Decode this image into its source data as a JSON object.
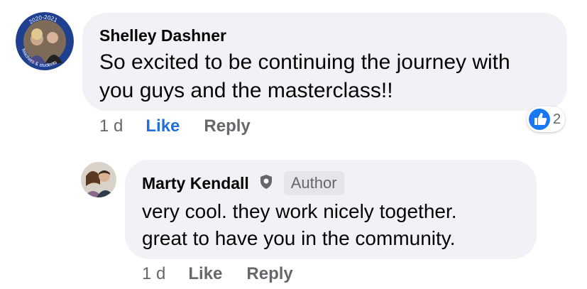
{
  "comments": [
    {
      "author": "Shelley Dashner",
      "text_lines": [
        "So excited to be continuing the journey with",
        "you guys and the masterclass!!"
      ],
      "time": "1 d",
      "like_label": "Like",
      "reply_label": "Reply",
      "reaction_count": "2",
      "avatar_text": "2020-2021",
      "avatar_caption": "teachers & students"
    },
    {
      "author": "Marty Kendall",
      "badge": "Author",
      "text_lines": [
        "very cool.  they work nicely together.",
        "great to have you in the community."
      ],
      "time": "1 d",
      "like_label": "Like",
      "reply_label": "Reply"
    }
  ],
  "icons": {
    "reaction": "like-thumb-icon",
    "admin": "shield-icon"
  },
  "colors": {
    "bubble": "#f0f2f5",
    "liked": "#216fdb",
    "meta": "#65676b",
    "reaction_blue": "#1877f2"
  }
}
